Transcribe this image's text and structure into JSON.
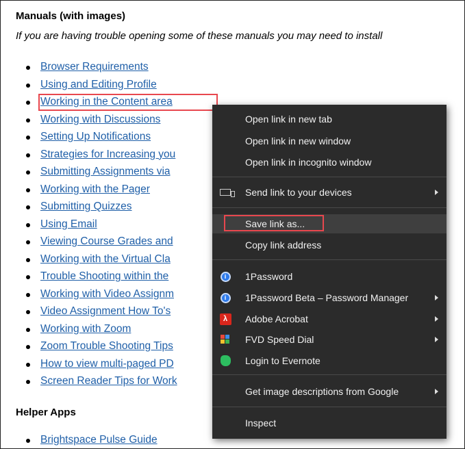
{
  "manuals": {
    "title": "Manuals (with images)",
    "intro": "If you are having trouble opening some of these manuals you may need to install",
    "links": [
      "Browser Requirements",
      "Using and Editing Profile",
      "Working in the Content area",
      "Working with Discussions",
      "Setting Up Notifications",
      "Strategies for Increasing you",
      "Submitting Assignments via",
      "Working with the Pager",
      "Submitting Quizzes",
      "Using Email",
      "Viewing Course Grades and",
      "Working with the Virtual Cla",
      "Trouble Shooting within the",
      "Working with Video Assignm",
      "Video Assignment How To's",
      "Working with Zoom",
      "Zoom Trouble Shooting Tips",
      "How to view multi-paged PD",
      "Screen Reader Tips for Work"
    ]
  },
  "helper_apps": {
    "title": "Helper Apps",
    "links": [
      "Brightspace Pulse Guide"
    ]
  },
  "context_menu": {
    "items": {
      "open_new_tab": "Open link in new tab",
      "open_new_window": "Open link in new window",
      "open_incognito": "Open link in incognito window",
      "send_to_devices": "Send link to your devices",
      "save_link_as": "Save link as...",
      "copy_link_address": "Copy link address",
      "onepassword": "1Password",
      "onepassword_beta": "1Password Beta – Password Manager",
      "adobe_acrobat": "Adobe Acrobat",
      "fvd_speed_dial": "FVD Speed Dial",
      "login_evernote": "Login to Evernote",
      "image_descriptions": "Get image descriptions from Google",
      "inspect": "Inspect"
    },
    "icons": {
      "devices": "devices-icon",
      "onepassword": "1password-icon",
      "acrobat": "adobe-acrobat-icon",
      "fvd": "fvd-speed-dial-icon",
      "evernote": "evernote-icon"
    }
  },
  "colors": {
    "link": "#1f5fa8",
    "menu_bg": "#2b2b2b",
    "highlight_box": "#e8474e"
  }
}
